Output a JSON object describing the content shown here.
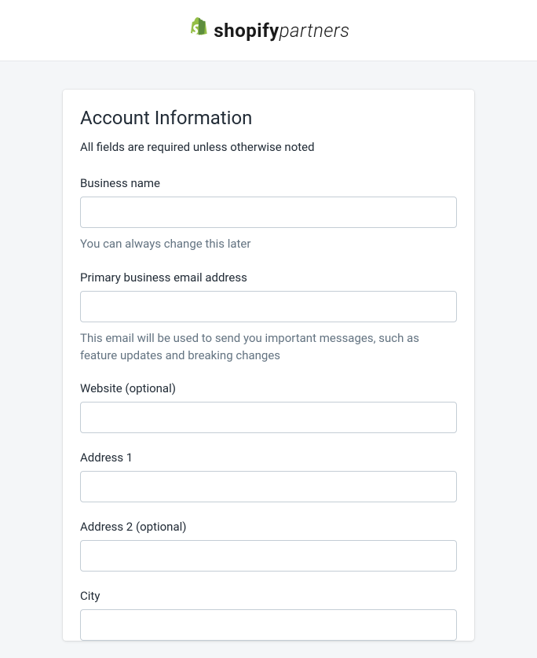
{
  "header": {
    "brand_bold": "shopify",
    "brand_light": "partners"
  },
  "form": {
    "title": "Account Information",
    "subtitle": "All fields are required unless otherwise noted",
    "fields": {
      "business_name": {
        "label": "Business name",
        "value": "",
        "help": "You can always change this later"
      },
      "email": {
        "label": "Primary business email address",
        "value": "",
        "help": "This email will be used to send you important messages, such as feature updates and breaking changes"
      },
      "website": {
        "label": "Website (optional)",
        "value": ""
      },
      "address1": {
        "label": "Address 1",
        "value": ""
      },
      "address2": {
        "label": "Address 2 (optional)",
        "value": ""
      },
      "city": {
        "label": "City",
        "value": ""
      }
    }
  }
}
